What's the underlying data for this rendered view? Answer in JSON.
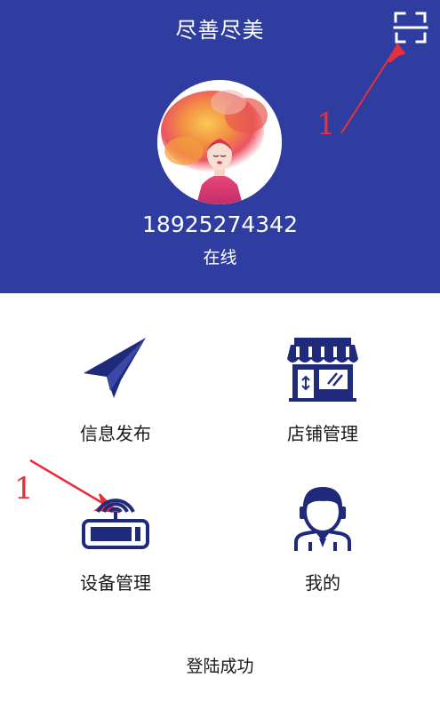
{
  "header": {
    "title": "尽善尽美",
    "scan_icon": "scan-icon",
    "phone": "18925274342",
    "status": "在线",
    "background": "#2e3d9f"
  },
  "annotations": {
    "scan_marker": "1",
    "device_marker": "1",
    "color": "#e8303a"
  },
  "menu": {
    "items": [
      {
        "label": "信息发布",
        "icon": "paper-plane-icon"
      },
      {
        "label": "店铺管理",
        "icon": "shop-icon"
      },
      {
        "label": "设备管理",
        "icon": "router-icon"
      },
      {
        "label": "我的",
        "icon": "user-icon"
      }
    ],
    "icon_color": "#1f2a7a"
  },
  "footer": {
    "login_message": "登陆成功"
  }
}
